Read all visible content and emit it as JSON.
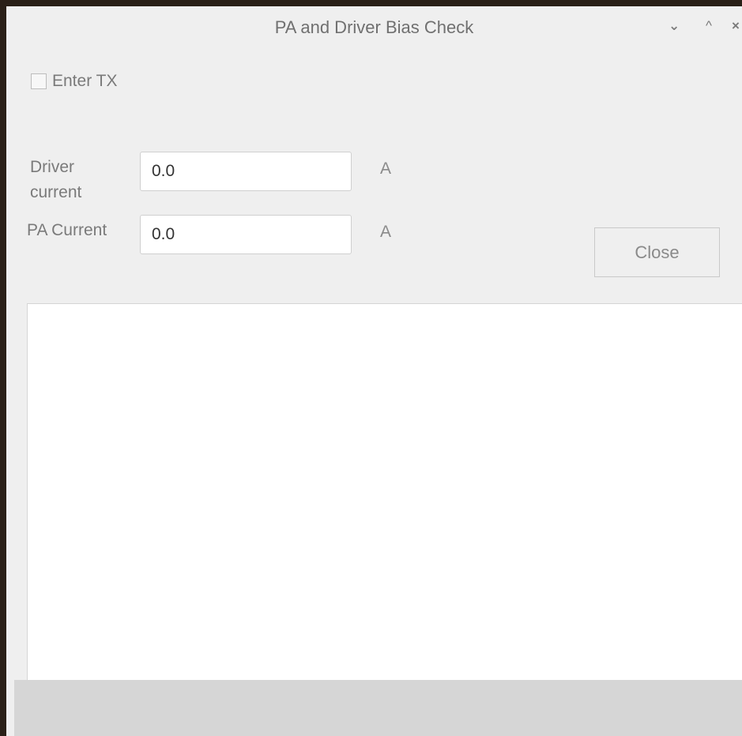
{
  "window": {
    "title": "PA and Driver Bias Check",
    "minimize_glyph": "⌄",
    "maximize_glyph": "^",
    "close_glyph": "×"
  },
  "controls": {
    "enter_tx": {
      "label": "Enter TX",
      "checked": false
    },
    "driver_current": {
      "label": "Driver current",
      "value": "0.0",
      "unit": "A"
    },
    "pa_current": {
      "label": "PA Current",
      "value": "0.0",
      "unit": "A"
    },
    "close_label": "Close"
  },
  "log": {
    "text": ""
  },
  "colors": {
    "window_bg": "#efefef",
    "text_muted": "#7a7a7a",
    "input_bg": "#ffffff",
    "statusbar_bg": "#d6d6d6"
  }
}
